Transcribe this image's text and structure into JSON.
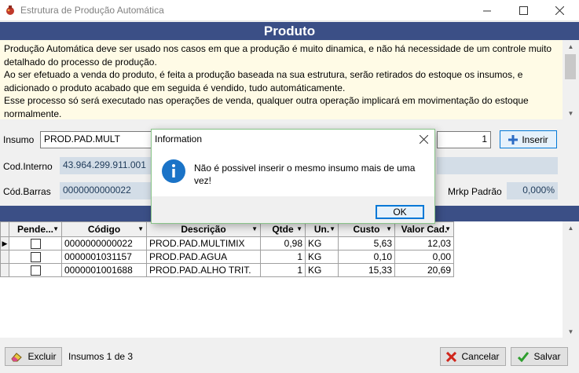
{
  "window": {
    "title": "Estrutura de Produção Automática"
  },
  "header": {
    "title": "Produto"
  },
  "description": {
    "lines": [
      "Produção Automática deve ser usado nos casos em que a produção é muito dinamica, e não há necessidade de um controle muito detalhado do processo de produção.",
      "Ao ser efetuado a venda do produto, é feita a produção baseada na sua estrutura, serão retirados do estoque os insumos, e adicionado o produto acabado que em seguida é vendido, tudo automáticamente.",
      "Esse processo só será executado nas operações de venda, qualquer outra operação implicará em movimentação do estoque normalmente."
    ]
  },
  "form": {
    "insumo_label": "Insumo",
    "insumo_value": "PROD.PAD.MULT",
    "qtde_value": "1",
    "inserir_label": "Inserir",
    "cod_interno_label": "Cod.Interno",
    "cod_interno_value": "43.964.299.911.001",
    "cod_barras_label": "Cód.Barras",
    "cod_barras_value": "0000000000022",
    "mrkp_label": "Mrkp Padrão",
    "mrkp_value": "0,000%"
  },
  "grid": {
    "columns": [
      "Pende...",
      "Código",
      "Descrição",
      "Qtde",
      "Un.",
      "Custo",
      "Valor Cad."
    ],
    "rows": [
      {
        "codigo": "0000000000022",
        "descricao": "PROD.PAD.MULTIMIX",
        "qtde": "0,98",
        "un": "KG",
        "custo": "5,63",
        "valor": "12,03"
      },
      {
        "codigo": "0000001031157",
        "descricao": "PROD.PAD.AGUA",
        "qtde": "1",
        "un": "KG",
        "custo": "0,10",
        "valor": "0,00"
      },
      {
        "codigo": "0000001001688",
        "descricao": "PROD.PAD.ALHO TRIT.",
        "qtde": "1",
        "un": "KG",
        "custo": "15,33",
        "valor": "20,69"
      }
    ]
  },
  "footer": {
    "excluir_label": "Excluir",
    "status": "Insumos 1 de 3",
    "cancelar_label": "Cancelar",
    "salvar_label": "Salvar"
  },
  "dialog": {
    "title": "Information",
    "message": "Não é possivel inserir o mesmo insumo mais de uma vez!",
    "ok_label": "OK"
  },
  "colors": {
    "header_bg": "#3b4f86",
    "description_bg": "#fffbe6",
    "readonly_bg": "#d3dde7",
    "accent": "#0078d7",
    "info_icon": "#1a73c7"
  }
}
